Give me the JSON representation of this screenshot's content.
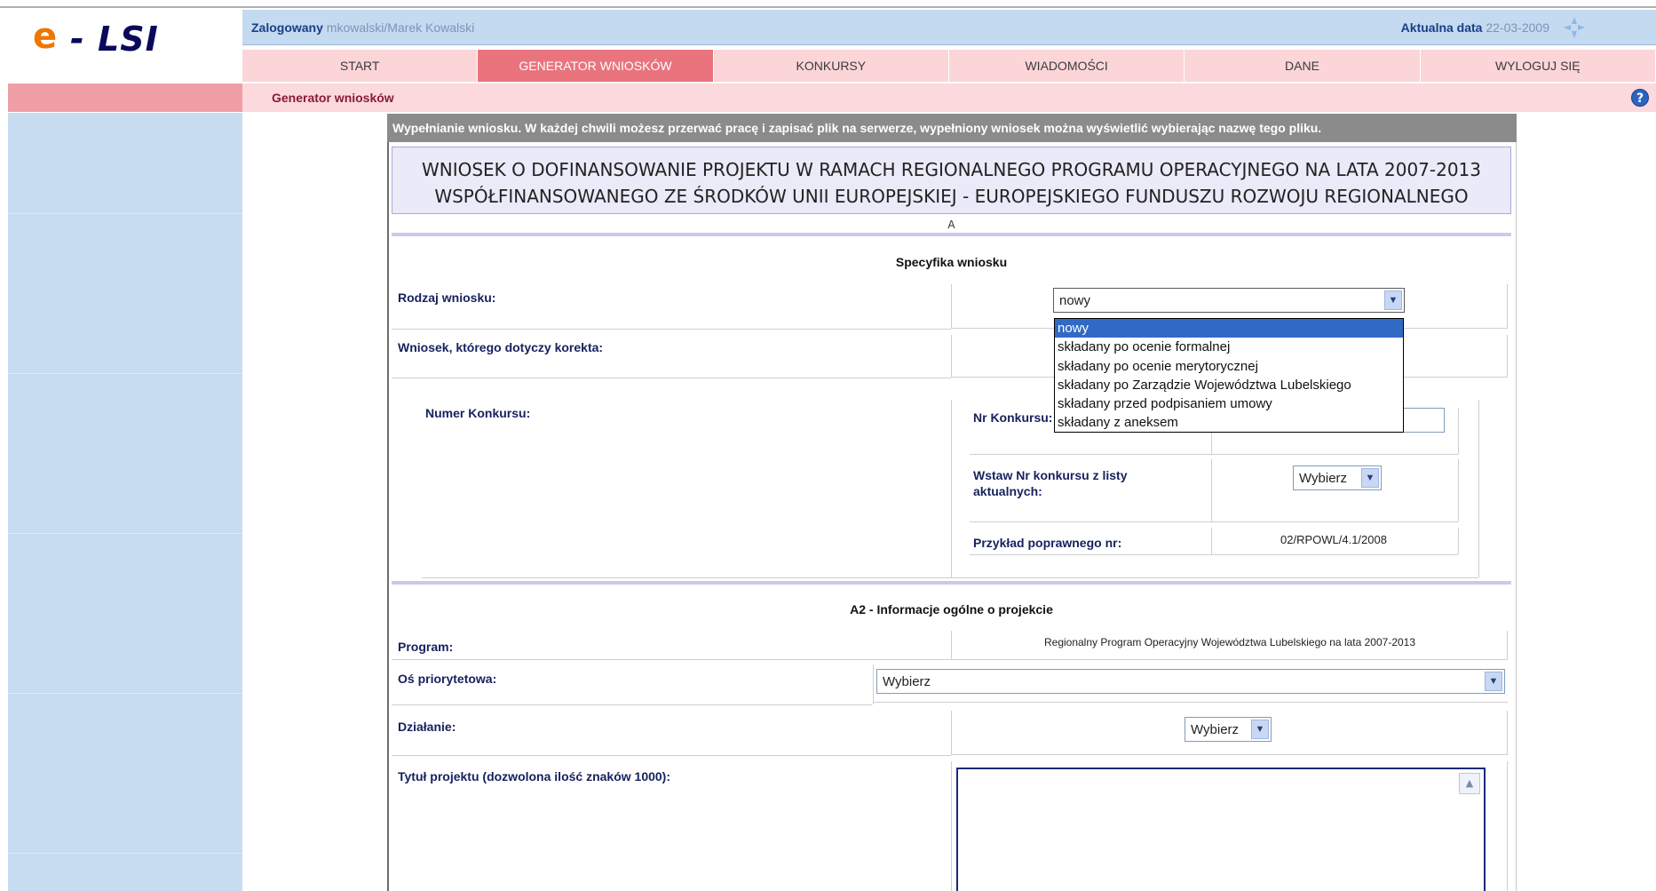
{
  "logo": {
    "e": "e",
    "rest": "- LSI"
  },
  "userbar": {
    "logged_label": "Zalogowany",
    "logged_user": "mkowalski/Marek Kowalski",
    "date_label": "Aktualna data",
    "date_value": "22-03-2009"
  },
  "nav": {
    "items": [
      "START",
      "GENERATOR WNIOSKÓW",
      "KONKURSY",
      "WIADOMOŚCI",
      "DANE",
      "WYLOGUJ SIĘ"
    ],
    "active": 1
  },
  "breadcrumb": "Generator wniosków",
  "info_text": "Wypełnianie wniosku. W każdej chwili możesz przerwać pracę i zapisać plik na serwerze, wypełniony wniosek można wyświetlić wybierając nazwę tego pliku.",
  "title": {
    "line1": "WNIOSEK O DOFINANSOWANIE PROJEKTU W RAMACH REGIONALNEGO PROGRAMU OPERACYJNEGO NA LATA 2007-2013",
    "line2": "WSPÓŁFINANSOWANEGO ZE ŚRODKÓW UNII EUROPEJSKIEJ - EUROPEJSKIEGO FUNDUSZU ROZWOJU REGIONALNEGO"
  },
  "section_a": "A",
  "spec": {
    "title": "Specyfika wniosku",
    "rodzaj_label": "Rodzaj wniosku:",
    "rodzaj_value": "nowy",
    "rodzaj_options": [
      "nowy",
      "składany po ocenie formalnej",
      "składany po ocenie merytorycznej",
      "składany po Zarządzie Województwa Lubelskiego",
      "składany przed podpisaniem umowy",
      "składany z aneksem"
    ],
    "korekta_label": "Wniosek, którego dotyczy korekta:",
    "numer_label": "Numer Konkursu:",
    "nr_konkursu_label": "Nr Konkursu:",
    "wstaw_label": "Wstaw Nr konkursu z listy aktualnych:",
    "wstaw_value": "Wybierz",
    "przyklad_label": "Przykład poprawnego nr:",
    "przyklad_value": "02/RPOWL/4.1/2008"
  },
  "a2": {
    "title": "A2 - Informacje ogólne o projekcie",
    "program_label": "Program:",
    "program_value": "Regionalny Program Operacyjny Województwa Lubelskiego na lata 2007-2013",
    "os_label": "Oś priorytetowa:",
    "os_value": "Wybierz",
    "dzialanie_label": "Działanie:",
    "dzialanie_value": "Wybierz",
    "tytul_label": "Tytuł projektu (dozwolona ilość znaków 1000):"
  },
  "icons": {
    "compass": "compass-icon",
    "help": "help-icon",
    "dropdown": "chevron-down-icon"
  },
  "colors": {
    "nav_active": "#e9747e",
    "nav_bg": "#fbd5d8",
    "sidebar": "#c7dcf0",
    "info_bar": "#8b8b8b",
    "selected_option": "#316ac5"
  }
}
